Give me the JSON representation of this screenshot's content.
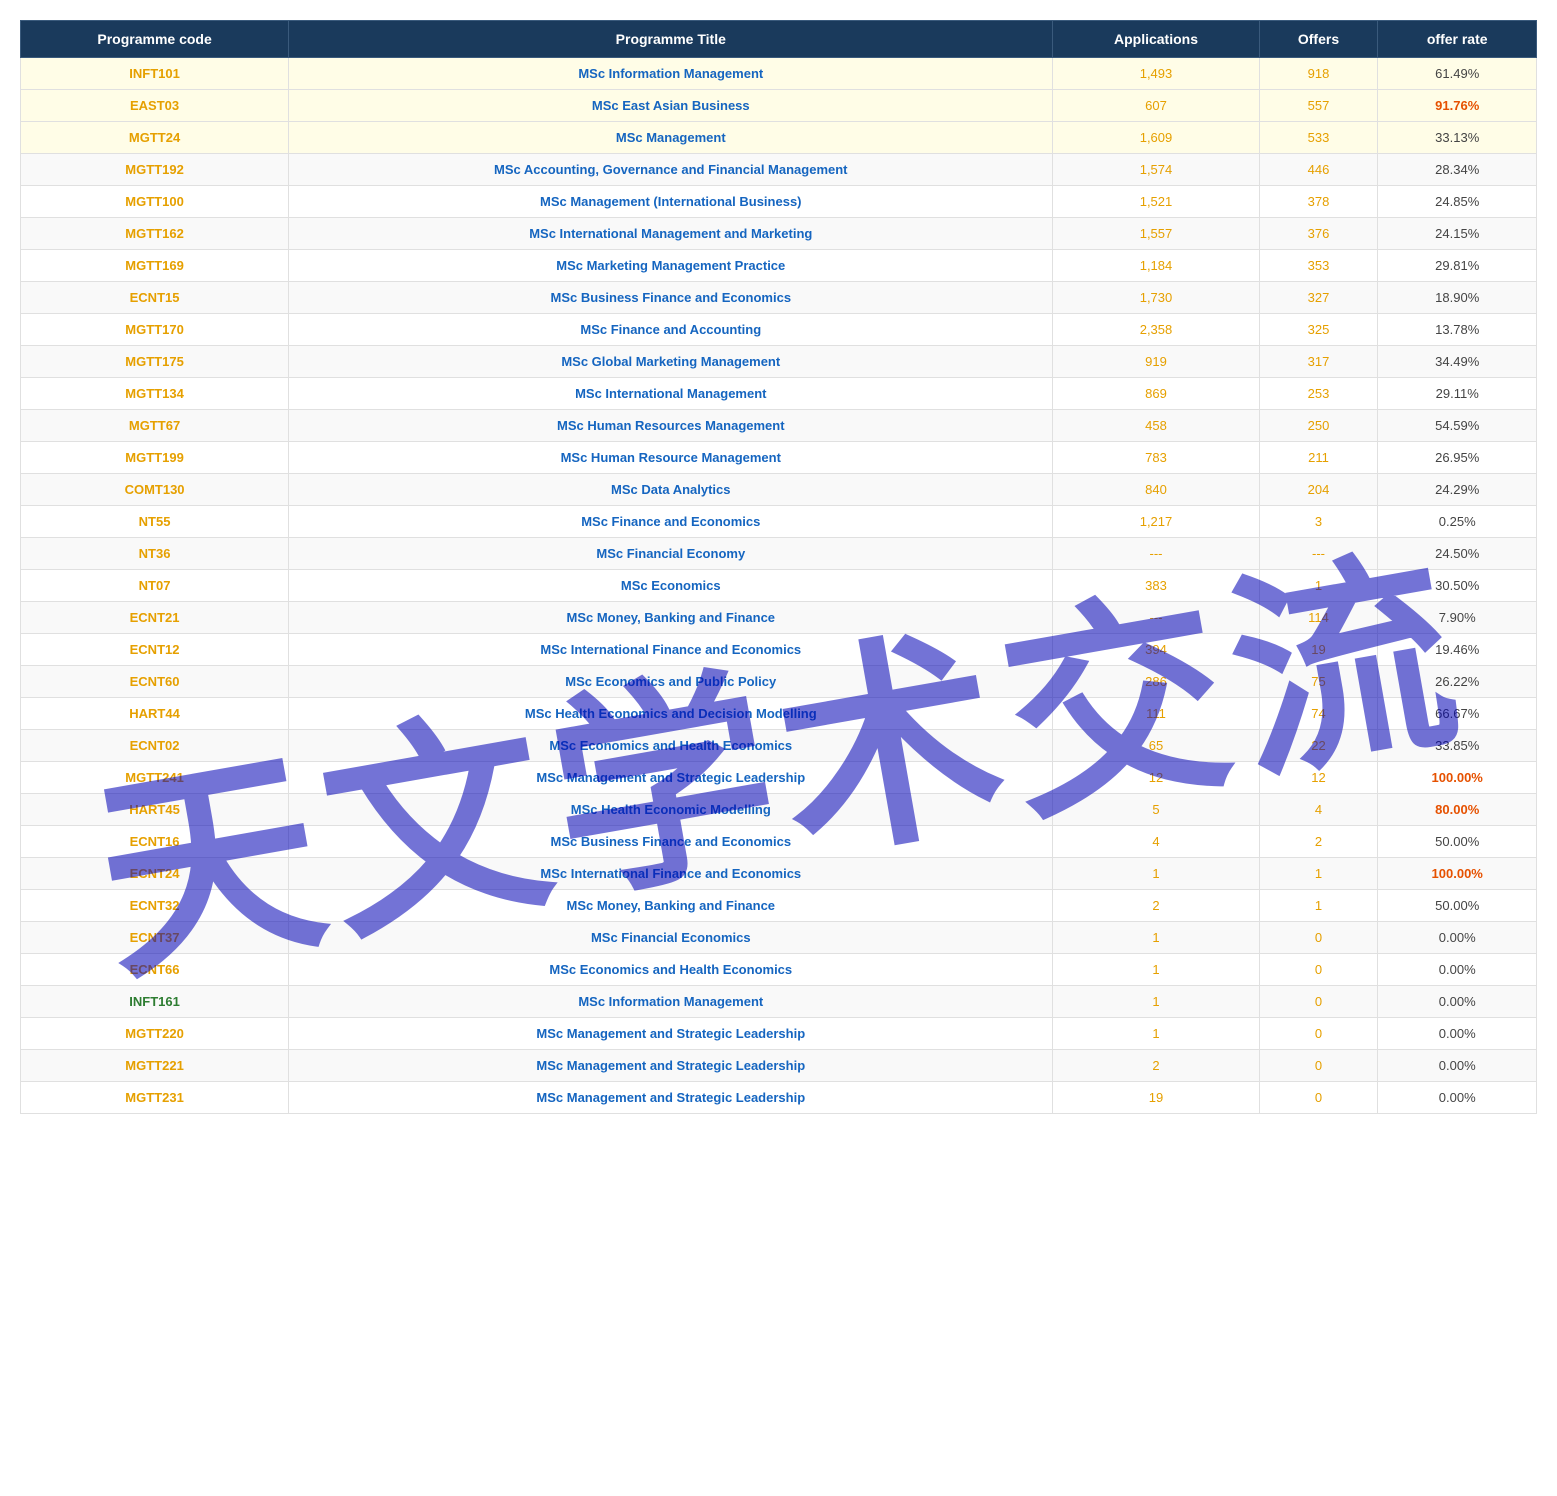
{
  "watermark": {
    "text": "天文学术交流"
  },
  "table": {
    "headers": [
      "Programme code",
      "Programme Title",
      "Applications",
      "Offers",
      "offer rate"
    ],
    "rows": [
      {
        "code": "INFT101",
        "title": "MSc Information Management",
        "apps": "1,493",
        "offers": "918",
        "rate": "61.49%",
        "highlight": true
      },
      {
        "code": "EAST03",
        "title": "MSc East Asian Business",
        "apps": "607",
        "offers": "557",
        "rate": "91.76%",
        "highlight": true,
        "rate_color": "orange"
      },
      {
        "code": "MGTT24",
        "title": "MSc Management",
        "apps": "1,609",
        "offers": "533",
        "rate": "33.13%",
        "highlight": true
      },
      {
        "code": "MGTT192",
        "title": "MSc Accounting, Governance and Financial Management",
        "apps": "1,574",
        "offers": "446",
        "rate": "28.34%"
      },
      {
        "code": "MGTT100",
        "title": "MSc Management (International Business)",
        "apps": "1,521",
        "offers": "378",
        "rate": "24.85%"
      },
      {
        "code": "MGTT162",
        "title": "MSc International Management and Marketing",
        "apps": "1,557",
        "offers": "376",
        "rate": "24.15%"
      },
      {
        "code": "MGTT169",
        "title": "MSc Marketing Management Practice",
        "apps": "1,184",
        "offers": "353",
        "rate": "29.81%"
      },
      {
        "code": "ECNT15",
        "title": "MSc Business Finance and Economics",
        "apps": "1,730",
        "offers": "327",
        "rate": "18.90%"
      },
      {
        "code": "MGTT170",
        "title": "MSc Finance and Accounting",
        "apps": "2,358",
        "offers": "325",
        "rate": "13.78%"
      },
      {
        "code": "MGTT175",
        "title": "MSc Global Marketing Management",
        "apps": "919",
        "offers": "317",
        "rate": "34.49%"
      },
      {
        "code": "MGTT134",
        "title": "MSc International Management",
        "apps": "869",
        "offers": "253",
        "rate": "29.11%"
      },
      {
        "code": "MGTT67",
        "title": "MSc Human Resources Management",
        "apps": "458",
        "offers": "250",
        "rate": "54.59%"
      },
      {
        "code": "MGTT199",
        "title": "MSc Human Resource Management",
        "apps": "783",
        "offers": "211",
        "rate": "26.95%"
      },
      {
        "code": "COMT130",
        "title": "MSc Data Analytics",
        "apps": "840",
        "offers": "204",
        "rate": "24.29%"
      },
      {
        "code": "NT55",
        "title": "MSc Finance and Economics",
        "apps": "1,217",
        "offers": "3",
        "rate": "0.25%"
      },
      {
        "code": "NT36",
        "title": "MSc Financial Economy",
        "apps": "---",
        "offers": "---",
        "rate": "24.50%"
      },
      {
        "code": "NT07",
        "title": "MSc Economics",
        "apps": "383",
        "offers": "1",
        "rate": "30.50%"
      },
      {
        "code": "ECNT21",
        "title": "MSc Money, Banking and Finance",
        "apps": "---",
        "offers": "114",
        "rate": "7.90%"
      },
      {
        "code": "ECNT12",
        "title": "MSc International Finance and Economics",
        "apps": "394",
        "offers": "19",
        "rate": "19.46%"
      },
      {
        "code": "ECNT60",
        "title": "MSc Economics and Public Policy",
        "apps": "286",
        "offers": "75",
        "rate": "26.22%"
      },
      {
        "code": "HART44",
        "title": "MSc Health Economics and Decision Modelling",
        "apps": "111",
        "offers": "74",
        "rate": "66.67%"
      },
      {
        "code": "ECNT02",
        "title": "MSc Economics and Health Economics",
        "apps": "65",
        "offers": "22",
        "rate": "33.85%"
      },
      {
        "code": "MGTT241",
        "title": "MSc Management and Strategic Leadership",
        "apps": "12",
        "offers": "12",
        "rate": "100.00%",
        "rate_color": "orange"
      },
      {
        "code": "HART45",
        "title": "MSc Health Economic Modelling",
        "apps": "5",
        "offers": "4",
        "rate": "80.00%",
        "rate_color": "orange"
      },
      {
        "code": "ECNT16",
        "title": "MSc Business Finance and Economics",
        "apps": "4",
        "offers": "2",
        "rate": "50.00%"
      },
      {
        "code": "ECNT24",
        "title": "MSc International Finance and Economics",
        "apps": "1",
        "offers": "1",
        "rate": "100.00%",
        "rate_color": "orange"
      },
      {
        "code": "ECNT32",
        "title": "MSc Money, Banking and Finance",
        "apps": "2",
        "offers": "1",
        "rate": "50.00%"
      },
      {
        "code": "ECNT37",
        "title": "MSc Financial Economics",
        "apps": "1",
        "offers": "0",
        "rate": "0.00%",
        "code_color": "orange"
      },
      {
        "code": "ECNT66",
        "title": "MSc Economics and Health Economics",
        "apps": "1",
        "offers": "0",
        "rate": "0.00%",
        "code_color": "orange"
      },
      {
        "code": "INFT161",
        "title": "MSc Information Management",
        "apps": "1",
        "offers": "0",
        "rate": "0.00%",
        "code_color": "green"
      },
      {
        "code": "MGTT220",
        "title": "MSc Management and Strategic Leadership",
        "apps": "1",
        "offers": "0",
        "rate": "0.00%",
        "code_color": "orange"
      },
      {
        "code": "MGTT221",
        "title": "MSc Management and Strategic Leadership",
        "apps": "2",
        "offers": "0",
        "rate": "0.00%",
        "code_color": "orange"
      },
      {
        "code": "MGTT231",
        "title": "MSc Management and Strategic Leadership",
        "apps": "19",
        "offers": "0",
        "rate": "0.00%",
        "code_color": "orange"
      }
    ]
  }
}
